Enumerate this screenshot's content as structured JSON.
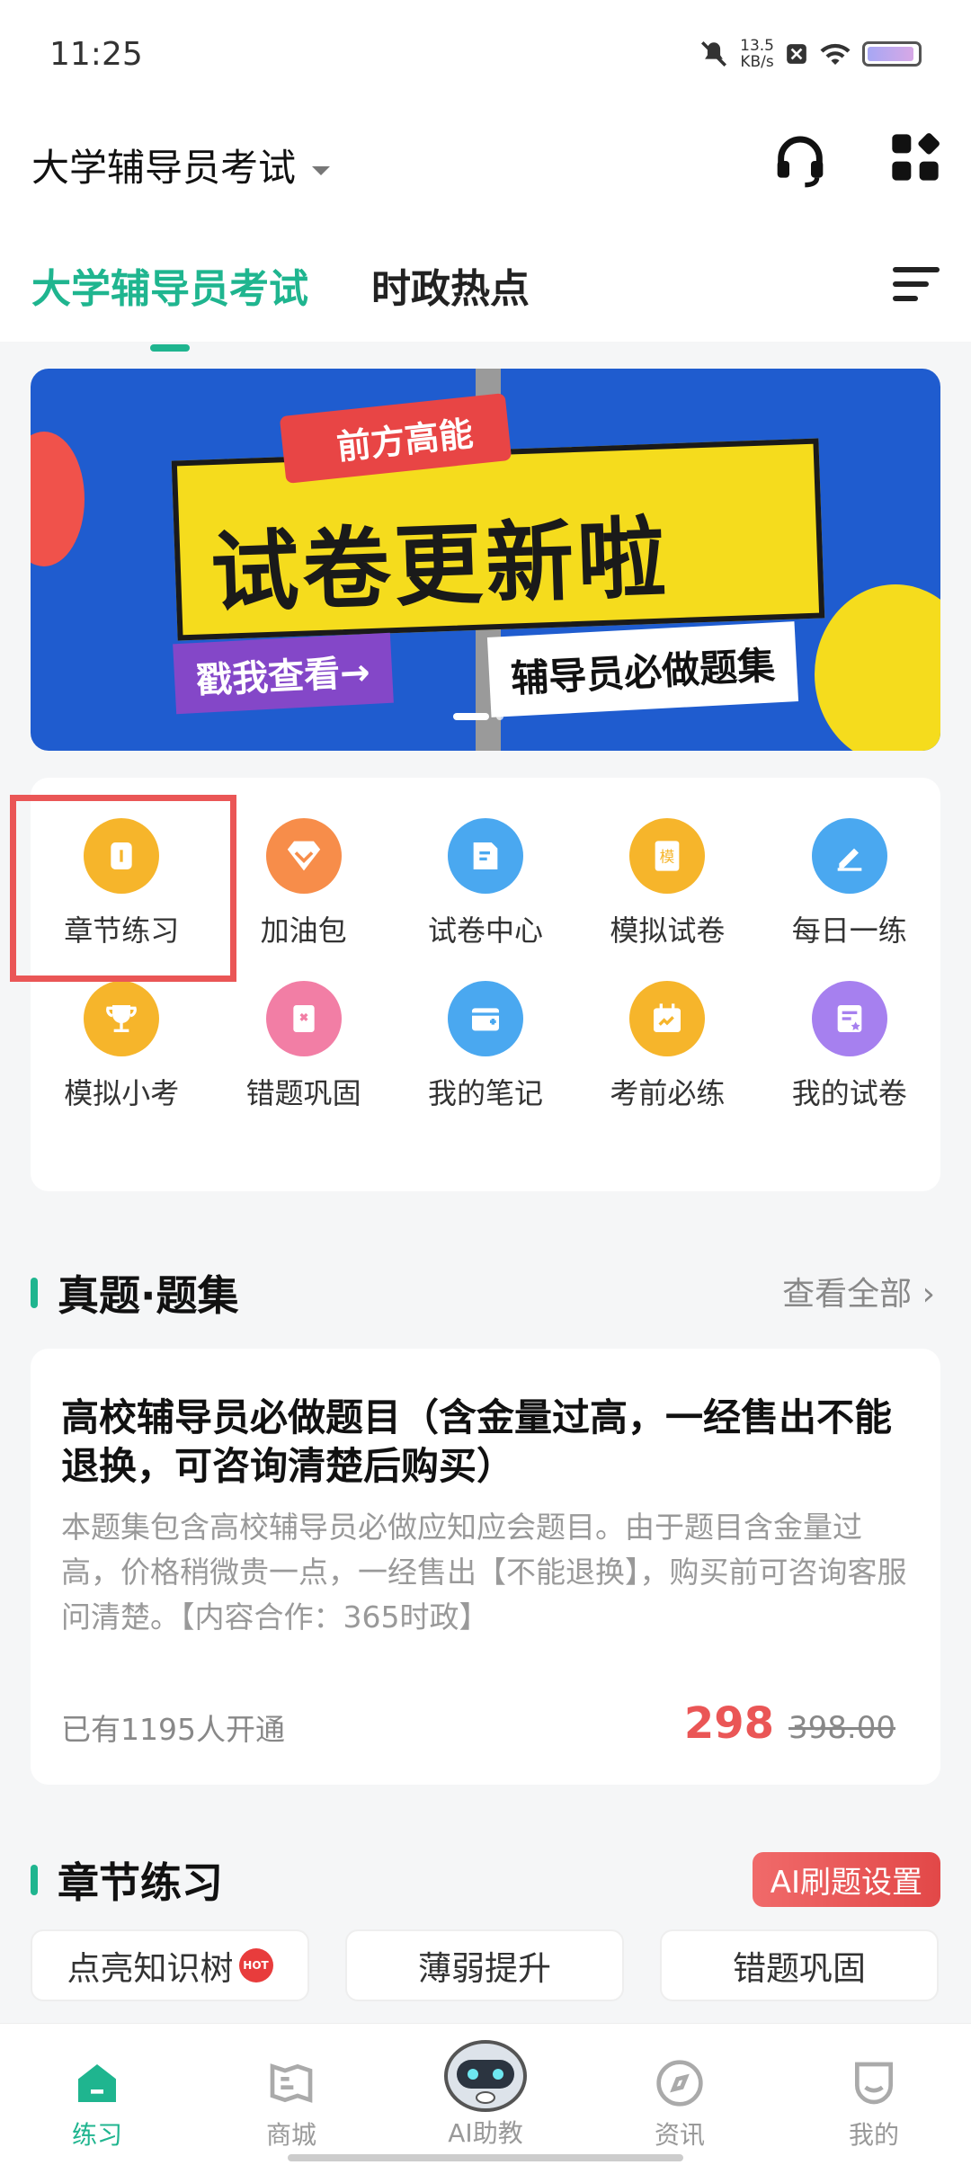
{
  "status": {
    "time": "11:25",
    "speed_top": "13.5",
    "speed_unit": "KB/s"
  },
  "header": {
    "exam_selector": "大学辅导员考试",
    "tabs": [
      "大学辅导员考试",
      "时政热点"
    ]
  },
  "banner": {
    "tag": "前方高能",
    "headline": "试卷更新啦",
    "cta_left": "戳我查看→",
    "cta_right": "辅导员必做题集"
  },
  "features": [
    {
      "label": "章节练习",
      "color": "#f6b52b",
      "icon": "chapter-icon"
    },
    {
      "label": "加油包",
      "color": "#f78d4a",
      "icon": "diamond-icon"
    },
    {
      "label": "试卷中心",
      "color": "#4aa8f0",
      "icon": "paper-icon"
    },
    {
      "label": "模拟试卷",
      "color": "#f6b52b",
      "icon": "mock-paper-icon"
    },
    {
      "label": "每日一练",
      "color": "#4aa8f0",
      "icon": "pen-icon"
    },
    {
      "label": "模拟小考",
      "color": "#f6b52b",
      "icon": "trophy-icon"
    },
    {
      "label": "错题巩固",
      "color": "#f27ea5",
      "icon": "wrong-book-icon"
    },
    {
      "label": "我的笔记",
      "color": "#4aa8f0",
      "icon": "note-icon"
    },
    {
      "label": "考前必练",
      "color": "#f6b52b",
      "icon": "calendar-icon"
    },
    {
      "label": "我的试卷",
      "color": "#a680ef",
      "icon": "my-paper-icon"
    }
  ],
  "questions_section": {
    "title": "真题·题集",
    "see_all": "查看全部"
  },
  "card": {
    "title": "高校辅导员必做题目（含金量过高，一经售出不能退换，可咨询清楚后购买）",
    "desc": "本题集包含高校辅导员必做应知应会题目。由于题目含金量过高，价格稍微贵一点，一经售出【不能退换】，购买前可咨询客服问清楚。【内容合作：365时政】",
    "subscribers": "已有1195人开通",
    "price": "298",
    "original_price": "398.00"
  },
  "chapter_section": {
    "title": "章节练习",
    "ai_button": "AI刷题设置",
    "chips": [
      "点亮知识树",
      "薄弱提升",
      "错题巩固"
    ],
    "hot_badge": "HOT"
  },
  "bottom_nav": [
    "练习",
    "商城",
    "AI助教",
    "资讯",
    "我的"
  ]
}
